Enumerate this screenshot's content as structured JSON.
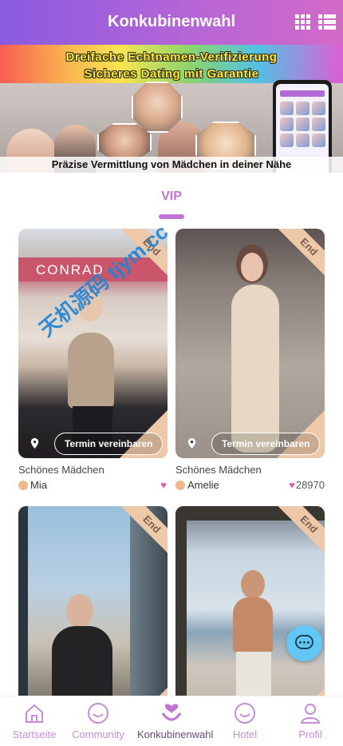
{
  "header": {
    "title": "Konkubinenwahl",
    "grid_icon": "grid-icon",
    "list_icon": "list-icon"
  },
  "banner": {
    "line1": "Dreifache Echtnamen-Verifizierung",
    "line2": "Sicheres Dating mit Garantie",
    "caption": "Präzise Vermittlung von Mädchen in deiner Nähe"
  },
  "tabs": {
    "active_label": "VIP"
  },
  "cards": [
    {
      "ribbon": "End",
      "appointment": "Termin vereinbaren",
      "title": "Schönes Mädchen",
      "girl": "Mia",
      "likes": ""
    },
    {
      "ribbon": "End",
      "appointment": "Termin vereinbaren",
      "title": "Schönes Mädchen",
      "girl": "Amelie",
      "likes": "28970"
    },
    {
      "ribbon": "End"
    },
    {
      "ribbon": "End"
    }
  ],
  "watermark": "天机源码 tjym.cc",
  "nav": [
    {
      "label": "Startseite",
      "icon": "home-icon"
    },
    {
      "label": "Community",
      "icon": "smiley-icon"
    },
    {
      "label": "Konkubinenwahl",
      "icon": "heart-hand-icon"
    },
    {
      "label": "Hotel",
      "icon": "smiley-icon"
    },
    {
      "label": "Profil",
      "icon": "user-icon"
    }
  ],
  "colors": {
    "header_start": "#8a5be0",
    "header_end": "#d36ac8",
    "accent": "#c374d7",
    "ribbon": "#eec9a9",
    "heart": "#e05fa2",
    "chat_button": "#62c7f5"
  }
}
